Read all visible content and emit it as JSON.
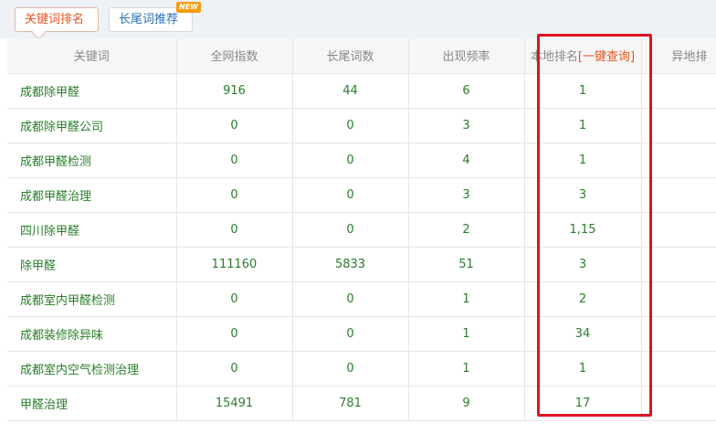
{
  "tabs": [
    {
      "label": "关键词排名",
      "active": true
    },
    {
      "label": "长尾词推荐",
      "active": false
    }
  ],
  "new_badge": "NEW",
  "table": {
    "headers": [
      "关键词",
      "全网指数",
      "长尾词数",
      "出现频率",
      "本地排名",
      "异地排"
    ],
    "one_click_label": "[一键查询]",
    "rows": [
      {
        "keyword": "成都除甲醛",
        "index": "916",
        "longtail": "44",
        "freq": "6",
        "local_rank": "1"
      },
      {
        "keyword": "成都除甲醛公司",
        "index": "0",
        "longtail": "0",
        "freq": "3",
        "local_rank": "1"
      },
      {
        "keyword": "成都甲醛检测",
        "index": "0",
        "longtail": "0",
        "freq": "4",
        "local_rank": "1"
      },
      {
        "keyword": "成都甲醛治理",
        "index": "0",
        "longtail": "0",
        "freq": "3",
        "local_rank": "3"
      },
      {
        "keyword": "四川除甲醛",
        "index": "0",
        "longtail": "0",
        "freq": "2",
        "local_rank": "1,15"
      },
      {
        "keyword": "除甲醛",
        "index": "111160",
        "longtail": "5833",
        "freq": "51",
        "local_rank": "3"
      },
      {
        "keyword": "成都室内甲醛检测",
        "index": "0",
        "longtail": "0",
        "freq": "1",
        "local_rank": "2"
      },
      {
        "keyword": "成都装修除异味",
        "index": "0",
        "longtail": "0",
        "freq": "1",
        "local_rank": "34"
      },
      {
        "keyword": "成都室内空气检测治理",
        "index": "0",
        "longtail": "0",
        "freq": "1",
        "local_rank": "1"
      },
      {
        "keyword": "甲醛治理",
        "index": "15491",
        "longtail": "781",
        "freq": "9",
        "local_rank": "17"
      }
    ]
  },
  "colors": {
    "accent": "#e8541e",
    "link_green": "#2a7d2a",
    "highlight_red": "#e0141e"
  }
}
